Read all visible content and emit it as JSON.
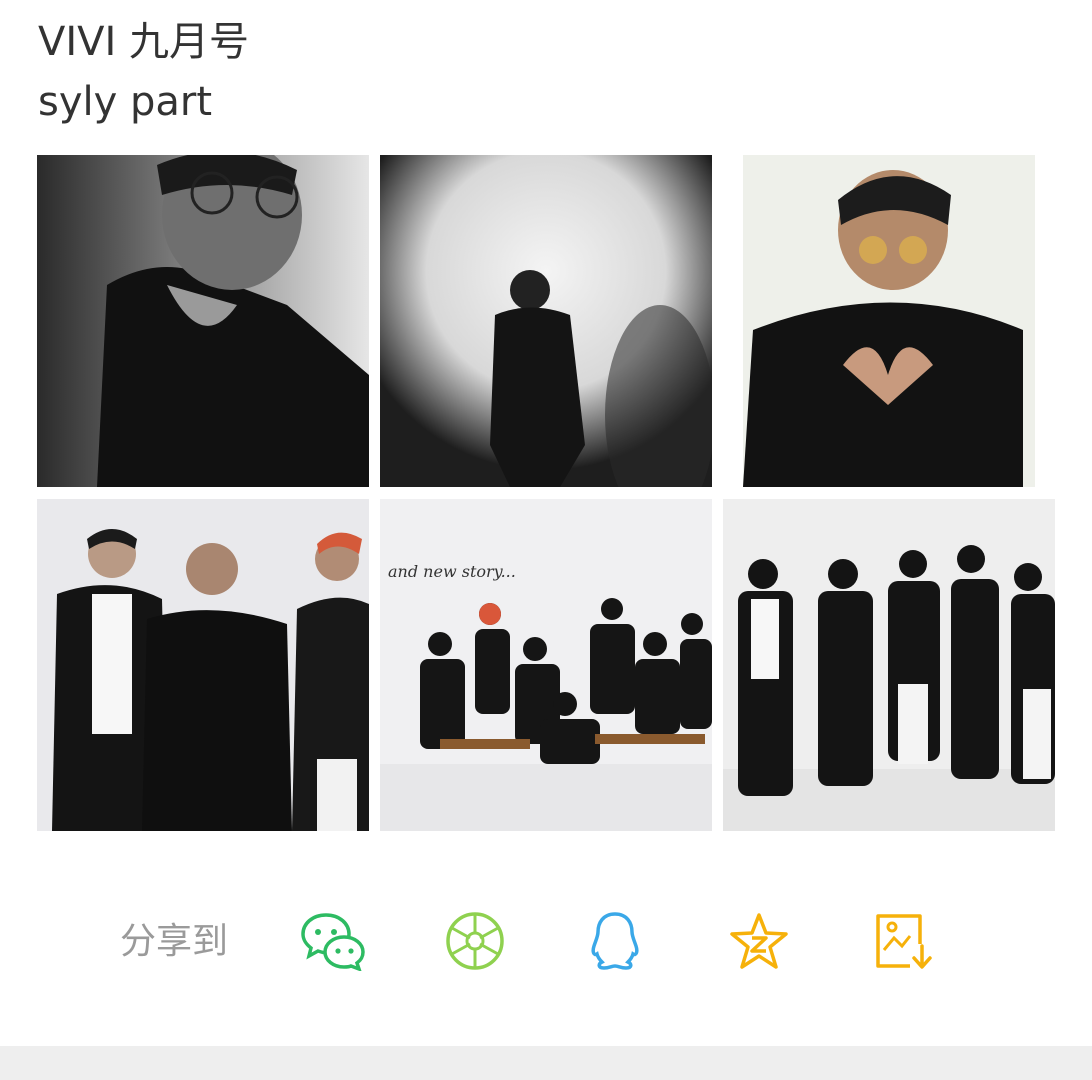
{
  "post": {
    "line1": "VIVI 九月号",
    "line2": "syly part"
  },
  "photos": [
    {
      "alt": "photo-1",
      "tone": "bw-portrait"
    },
    {
      "alt": "photo-2",
      "tone": "bw-spotlight"
    },
    {
      "alt": "photo-3",
      "tone": "color-heart-hands"
    },
    {
      "alt": "photo-4",
      "tone": "group-three"
    },
    {
      "alt": "photo-5",
      "tone": "group-seated"
    },
    {
      "alt": "photo-6",
      "tone": "group-standing"
    }
  ],
  "photo_overlay_text": "and new story...",
  "share": {
    "label": "分享到",
    "targets": [
      {
        "name": "wechat",
        "icon": "wechat-icon",
        "color": "#2dbb62"
      },
      {
        "name": "moments",
        "icon": "moments-icon",
        "color": "#8fd14f"
      },
      {
        "name": "qq",
        "icon": "qq-icon",
        "color": "#3aa8e8"
      },
      {
        "name": "qzone",
        "icon": "qzone-star-icon",
        "color": "#f6b10a"
      },
      {
        "name": "save-image",
        "icon": "save-image-icon",
        "color": "#f6b10a"
      }
    ]
  }
}
